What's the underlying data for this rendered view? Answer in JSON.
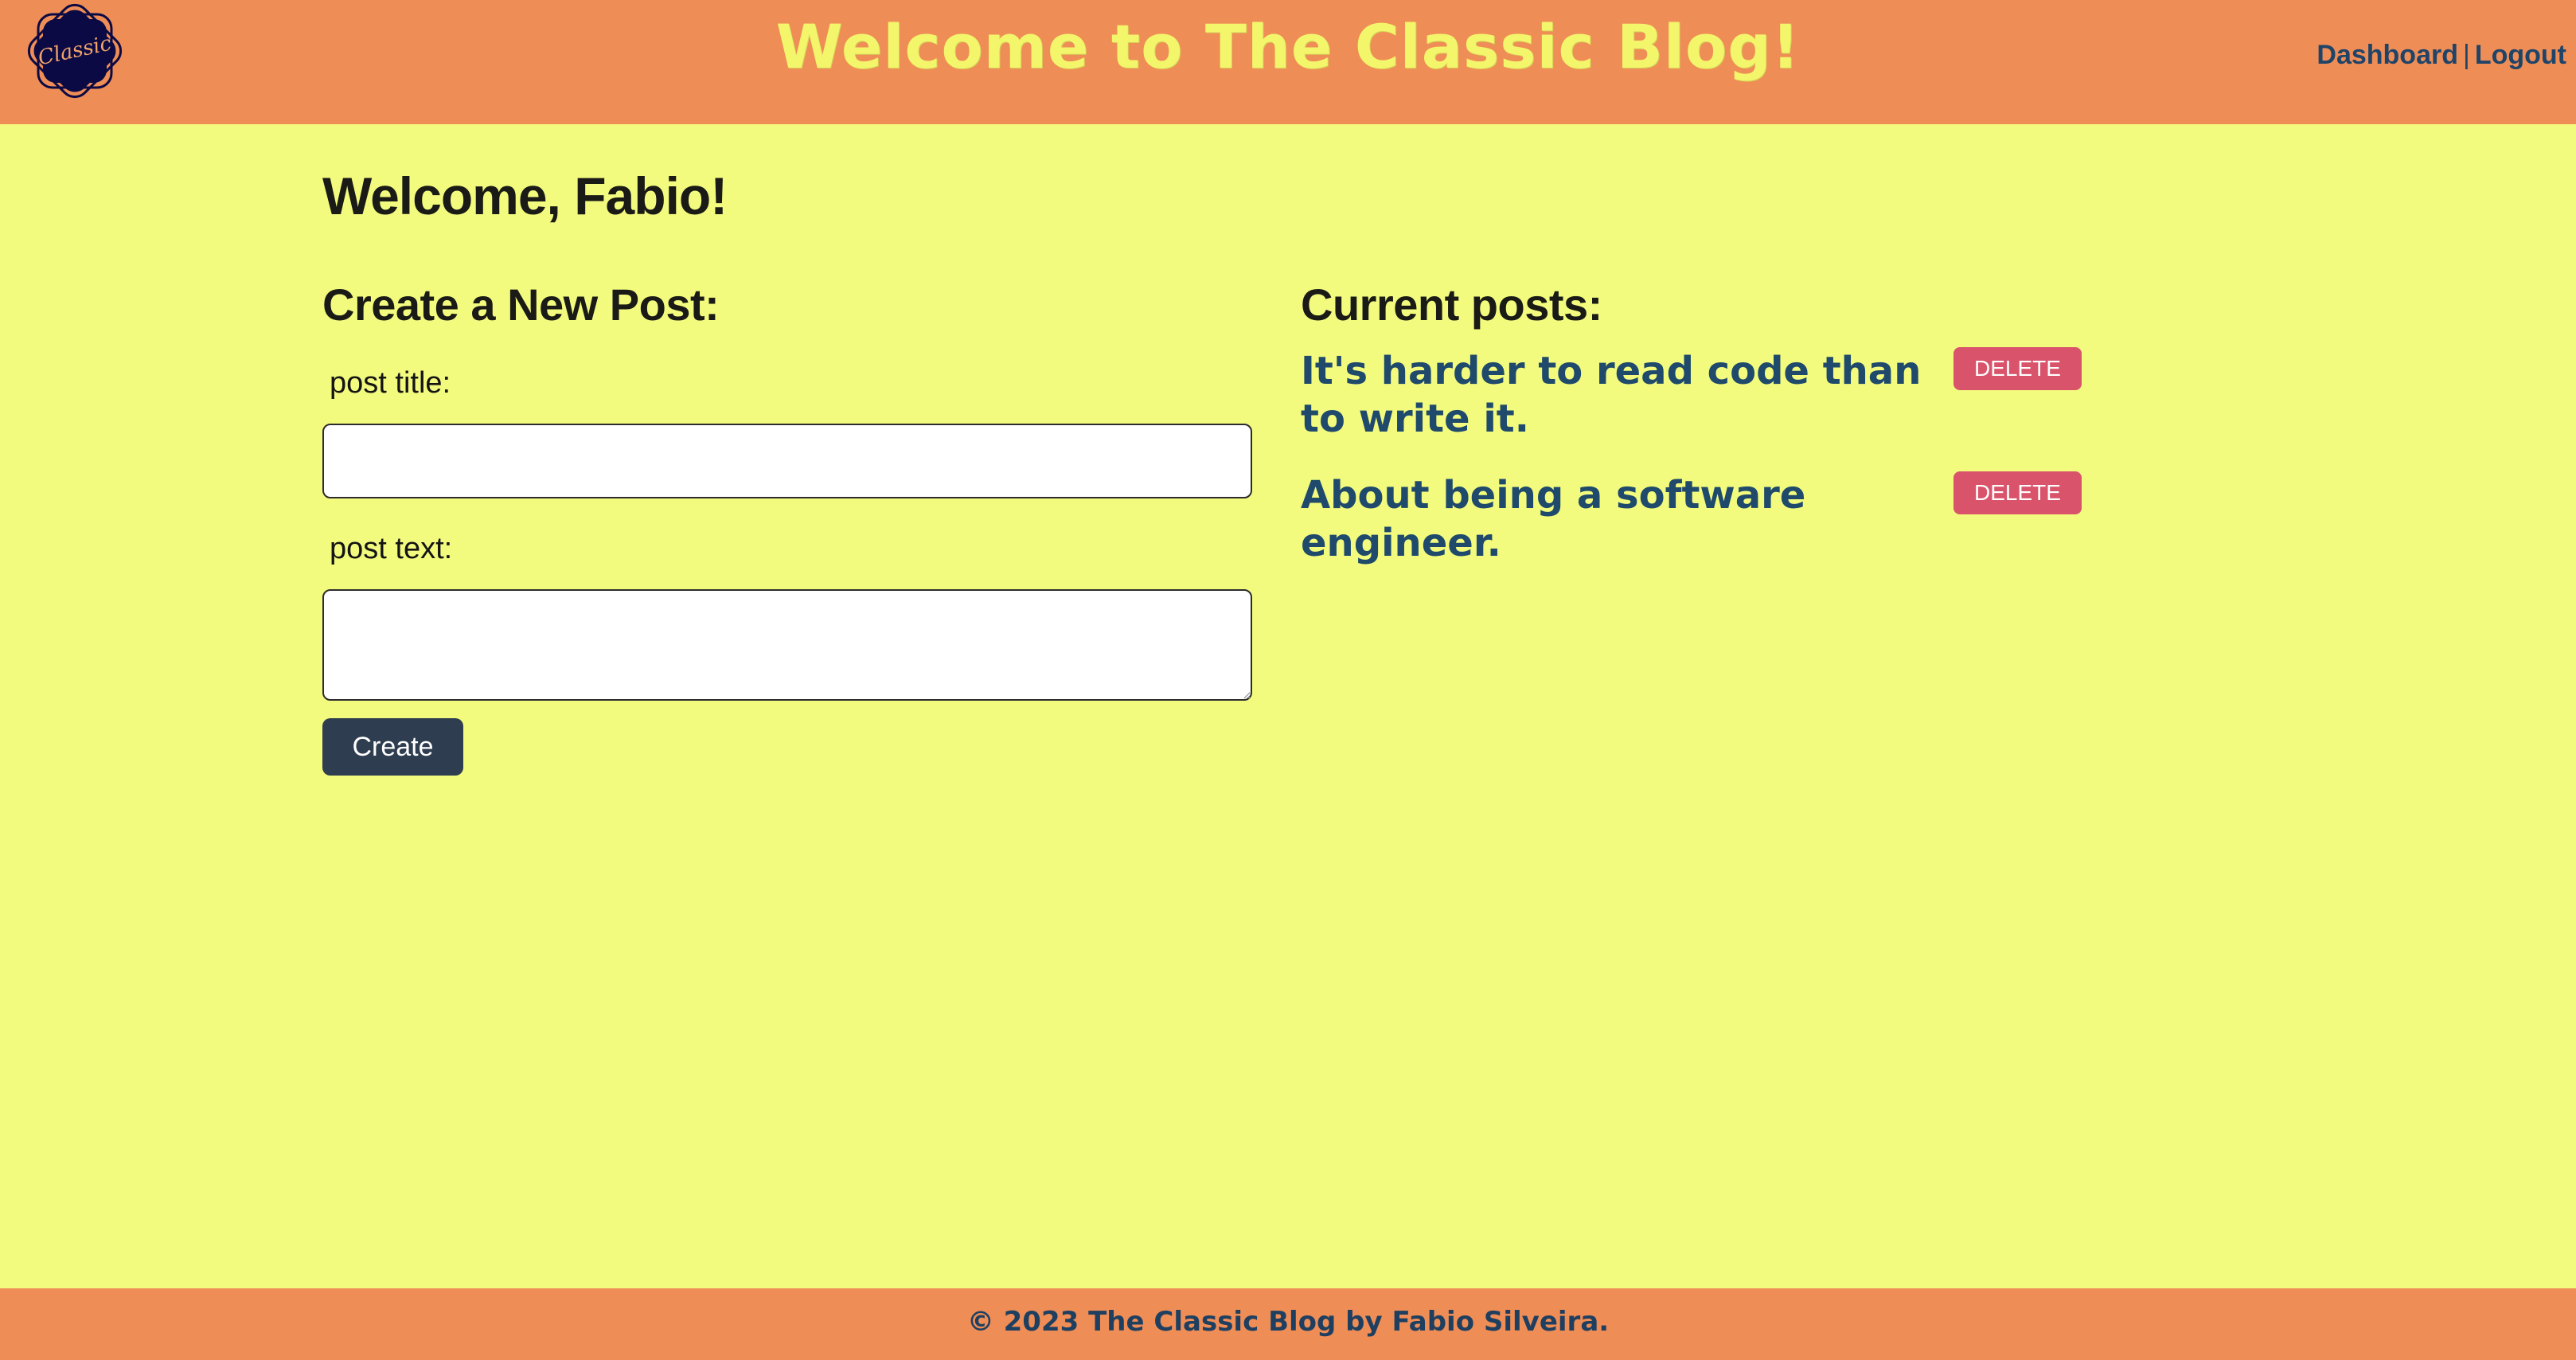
{
  "header": {
    "logo_text": "Classic",
    "title": "Welcome to The Classic Blog!",
    "nav": {
      "dashboard": "Dashboard",
      "separator": "|",
      "logout": "Logout"
    }
  },
  "main": {
    "welcome": "Welcome, Fabio!",
    "create": {
      "heading": "Create a New Post:",
      "title_label": "post title:",
      "title_value": "",
      "text_label": "post text:",
      "text_value": "",
      "button_label": "Create"
    },
    "posts": {
      "heading": "Current posts:",
      "items": [
        {
          "title": "It's harder to read code than to write it.",
          "delete_label": "DELETE"
        },
        {
          "title": "About being a software engineer.",
          "delete_label": "DELETE"
        }
      ]
    }
  },
  "footer": {
    "text": "© 2023 The Classic Blog by Fabio Silveira."
  },
  "colors": {
    "header_bg": "#ef8d56",
    "page_bg": "#f3fb7e",
    "title_yellow": "#f3f56b",
    "link_blue": "#1f4468",
    "create_button": "#2f3d50",
    "delete_button": "#d9536b"
  }
}
